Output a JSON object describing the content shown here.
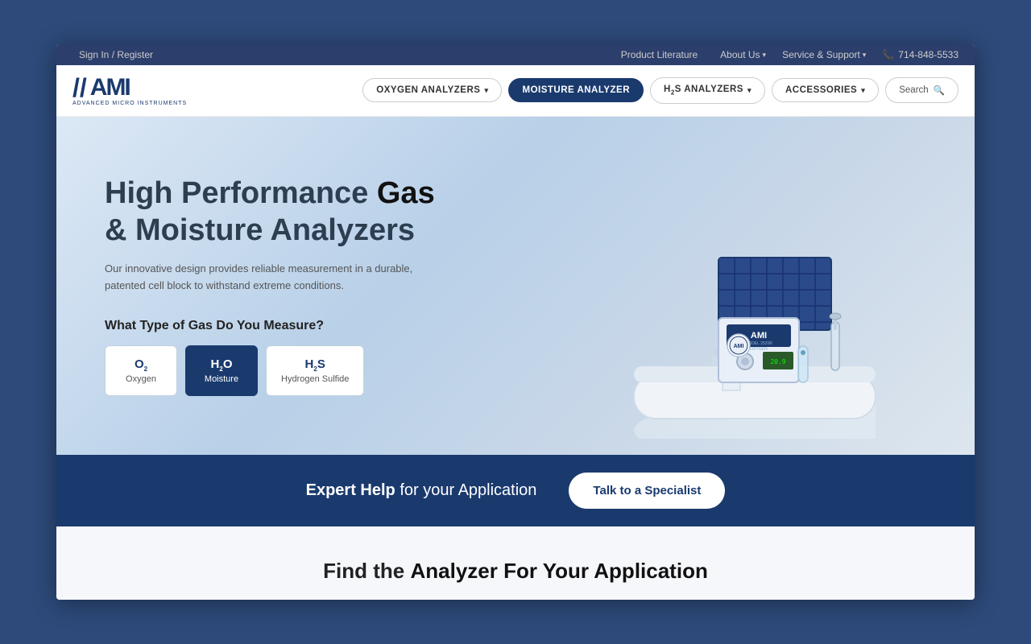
{
  "topbar": {
    "signin": "Sign In / Register",
    "product_literature": "Product Literature",
    "about_us": "About Us",
    "service_support": "Service & Support",
    "phone": "714-848-5533"
  },
  "nav": {
    "logo_main": "AMI",
    "logo_slashes": "//",
    "logo_subtitle": "Advanced Micro Instruments",
    "items": [
      {
        "id": "oxygen",
        "label": "OXYGEN ANALYZERS",
        "has_dropdown": true,
        "active": false
      },
      {
        "id": "moisture",
        "label": "MOISTURE ANALYZER",
        "has_dropdown": false,
        "active": true
      },
      {
        "id": "h2s",
        "label": "H₂S ANALYZERS",
        "has_dropdown": true,
        "active": false
      },
      {
        "id": "accessories",
        "label": "ACCESSORIES",
        "has_dropdown": true,
        "active": false
      }
    ],
    "search_label": "Search"
  },
  "hero": {
    "title_line1": "High Performance ",
    "title_bold": "Gas",
    "title_line2": "& Moisture Analyzers",
    "subtitle": "Our innovative design provides reliable measurement in a durable, patented cell block to withstand extreme conditions.",
    "gas_question": "What Type of Gas Do You Measure?",
    "gas_options": [
      {
        "formula": "O₂",
        "name": "Oxygen",
        "active": false
      },
      {
        "formula": "H₂O",
        "name": "Moisture",
        "active": true
      },
      {
        "formula": "H₂S",
        "name": "Hydrogen Sulfide",
        "active": false
      }
    ]
  },
  "expert_banner": {
    "text_bold": "Expert Help",
    "text_normal": " for your Application",
    "cta_label": "Talk to a Specialist"
  },
  "find_section": {
    "title_normal": "Find the ",
    "title_bold": "Analyzer For Your Application"
  }
}
